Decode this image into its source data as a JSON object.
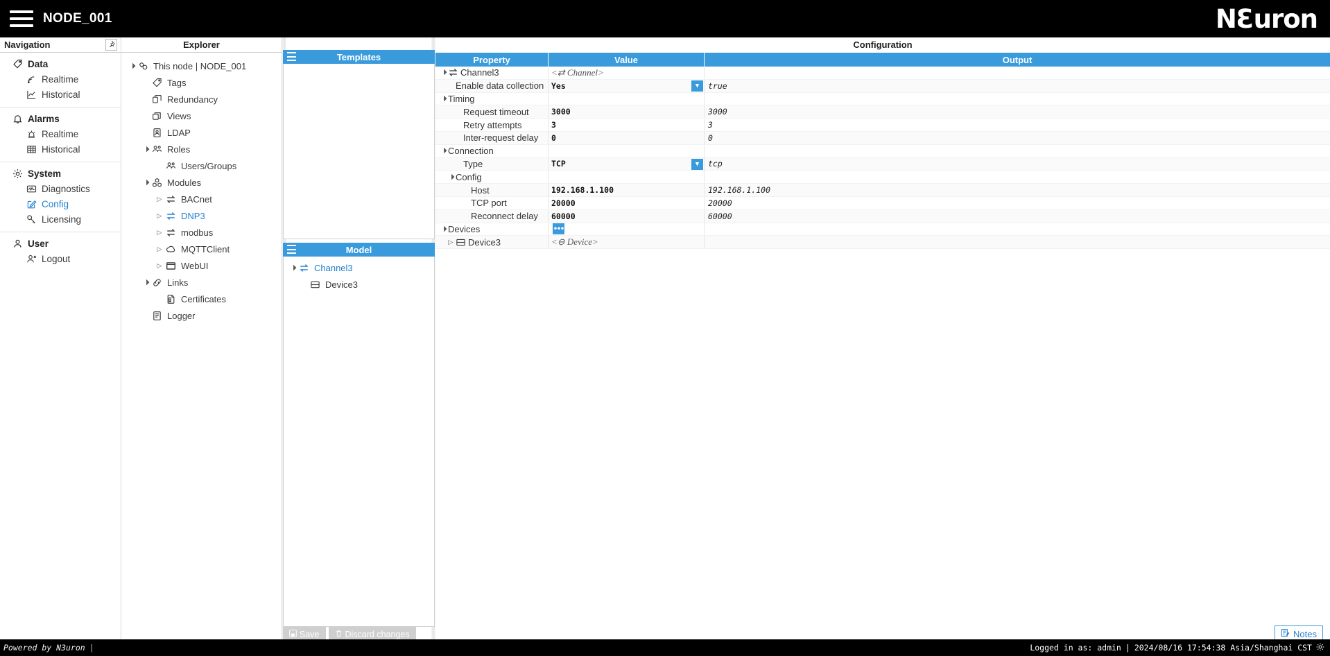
{
  "topbar": {
    "menu_icon": "hamburger-icon",
    "node_title": "NODE_001",
    "brand_a": "N",
    "brand_three": "3",
    "brand_b": "uron"
  },
  "navigation": {
    "title": "Navigation",
    "pin_icon": "pin-icon",
    "groups": [
      {
        "label": "Data",
        "icon": "tag-icon",
        "items": [
          {
            "label": "Realtime",
            "icon": "signal-icon",
            "active": false
          },
          {
            "label": "Historical",
            "icon": "chart-line-icon",
            "active": false
          }
        ]
      },
      {
        "label": "Alarms",
        "icon": "bell-icon",
        "items": [
          {
            "label": "Realtime",
            "icon": "siren-icon",
            "active": false
          },
          {
            "label": "Historical",
            "icon": "table-icon",
            "active": false
          }
        ]
      },
      {
        "label": "System",
        "icon": "gear-icon",
        "items": [
          {
            "label": "Diagnostics",
            "icon": "diagnostics-icon",
            "active": false
          },
          {
            "label": "Config",
            "icon": "edit-square-icon",
            "active": true
          },
          {
            "label": "Licensing",
            "icon": "key-icon",
            "active": false
          }
        ]
      },
      {
        "label": "User",
        "icon": "user-icon",
        "items": [
          {
            "label": "Logout",
            "icon": "user-logout-icon",
            "active": false
          }
        ]
      }
    ]
  },
  "explorer": {
    "title": "Explorer",
    "tree": [
      {
        "label": "This node | NODE_001",
        "icon": "node-icon",
        "depth": 0,
        "arrow": "open",
        "link": false
      },
      {
        "label": "Tags",
        "icon": "tag-icon",
        "depth": 1,
        "arrow": "none",
        "link": false
      },
      {
        "label": "Redundancy",
        "icon": "redundancy-icon",
        "depth": 1,
        "arrow": "none",
        "link": false
      },
      {
        "label": "Views",
        "icon": "views-icon",
        "depth": 1,
        "arrow": "none",
        "link": false
      },
      {
        "label": "LDAP",
        "icon": "ldap-icon",
        "depth": 1,
        "arrow": "none",
        "link": false
      },
      {
        "label": "Roles",
        "icon": "roles-icon",
        "depth": 1,
        "arrow": "open",
        "link": false
      },
      {
        "label": "Users/Groups",
        "icon": "users-groups-icon",
        "depth": 2,
        "arrow": "none",
        "link": false
      },
      {
        "label": "Modules",
        "icon": "modules-icon",
        "depth": 1,
        "arrow": "open",
        "link": false
      },
      {
        "label": "BACnet",
        "icon": "exchange-icon",
        "depth": 2,
        "arrow": "closed",
        "link": false
      },
      {
        "label": "DNP3",
        "icon": "exchange-icon",
        "depth": 2,
        "arrow": "closed",
        "link": true
      },
      {
        "label": "modbus",
        "icon": "exchange-icon",
        "depth": 2,
        "arrow": "closed",
        "link": false
      },
      {
        "label": "MQTTClient",
        "icon": "cloud-icon",
        "depth": 2,
        "arrow": "closed",
        "link": false
      },
      {
        "label": "WebUI",
        "icon": "window-icon",
        "depth": 2,
        "arrow": "closed",
        "link": false
      },
      {
        "label": "Links",
        "icon": "links-icon",
        "depth": 1,
        "arrow": "open",
        "link": false
      },
      {
        "label": "Certificates",
        "icon": "certificate-icon",
        "depth": 2,
        "arrow": "none",
        "link": false
      },
      {
        "label": "Logger",
        "icon": "logger-icon",
        "depth": 1,
        "arrow": "none",
        "link": false
      }
    ]
  },
  "templates": {
    "title": "Templates",
    "menu_icon": "hamburger-icon",
    "items": []
  },
  "model": {
    "title": "Model",
    "menu_icon": "hamburger-icon",
    "tree": [
      {
        "label": "Channel3",
        "icon": "exchange-icon",
        "depth": 0,
        "arrow": "open",
        "link": true
      },
      {
        "label": "Device3",
        "icon": "device-icon",
        "depth": 1,
        "arrow": "none",
        "link": false
      }
    ]
  },
  "configuration": {
    "title": "Configuration",
    "columns": [
      "Property",
      "Value",
      "Output"
    ],
    "rows": [
      {
        "property": "Channel3",
        "depth": 0,
        "arrow": "open",
        "icon": "exchange-icon",
        "value": "<⇄ Channel>",
        "value_style": "placeholder",
        "output": "",
        "control": "none"
      },
      {
        "property": "Enable data collection",
        "depth": 1,
        "arrow": "none",
        "icon": "none",
        "value": "Yes",
        "value_style": "normal",
        "output": "true",
        "control": "dropdown"
      },
      {
        "property": "Timing",
        "depth": 0,
        "arrow": "open",
        "icon": "none",
        "value": "",
        "value_style": "normal",
        "output": "",
        "control": "none"
      },
      {
        "property": "Request timeout",
        "depth": 2,
        "arrow": "none",
        "icon": "none",
        "value": "3000",
        "value_style": "normal",
        "output": "3000",
        "control": "none"
      },
      {
        "property": "Retry attempts",
        "depth": 2,
        "arrow": "none",
        "icon": "none",
        "value": "3",
        "value_style": "normal",
        "output": "3",
        "control": "none"
      },
      {
        "property": "Inter-request delay",
        "depth": 2,
        "arrow": "none",
        "icon": "none",
        "value": "0",
        "value_style": "normal",
        "output": "0",
        "control": "none"
      },
      {
        "property": "Connection",
        "depth": 0,
        "arrow": "open",
        "icon": "none",
        "value": "",
        "value_style": "normal",
        "output": "",
        "control": "none"
      },
      {
        "property": "Type",
        "depth": 2,
        "arrow": "none",
        "icon": "none",
        "value": "TCP",
        "value_style": "normal",
        "output": "tcp",
        "control": "dropdown"
      },
      {
        "property": "Config",
        "depth": 1,
        "arrow": "open",
        "icon": "none",
        "value": "",
        "value_style": "normal",
        "output": "",
        "control": "none"
      },
      {
        "property": "Host",
        "depth": 3,
        "arrow": "none",
        "icon": "none",
        "value": "192.168.1.100",
        "value_style": "normal",
        "output": "192.168.1.100",
        "control": "none"
      },
      {
        "property": "TCP port",
        "depth": 3,
        "arrow": "none",
        "icon": "none",
        "value": "20000",
        "value_style": "normal",
        "output": "20000",
        "control": "none"
      },
      {
        "property": "Reconnect delay",
        "depth": 3,
        "arrow": "none",
        "icon": "none",
        "value": "60000",
        "value_style": "normal",
        "output": "60000",
        "control": "none"
      },
      {
        "property": "Devices",
        "depth": 0,
        "arrow": "open",
        "icon": "none",
        "value": "",
        "value_style": "normal",
        "output": "",
        "control": "ellipsis"
      },
      {
        "property": "Device3",
        "depth": 1,
        "arrow": "closed",
        "icon": "device-icon",
        "value": "<⊖ Device>",
        "value_style": "placeholder",
        "output": "",
        "control": "none"
      }
    ]
  },
  "footer": {
    "save_label": "Save",
    "save_icon": "save-icon",
    "discard_label": "Discard changes",
    "discard_icon": "trash-icon",
    "notes_label": "Notes",
    "notes_icon": "notes-icon"
  },
  "statusbar": {
    "powered_by": "Powered by N3uron",
    "logged_in": "Logged in as: admin",
    "timestamp": "2024/08/16 17:54:38 Asia/Shanghai CST",
    "settings_icon": "gear-icon"
  },
  "colors": {
    "accent": "#3a9bdc",
    "link": "#1f7fd0",
    "topbar_bg": "#000000",
    "button_disabled": "#cfcfcf"
  }
}
